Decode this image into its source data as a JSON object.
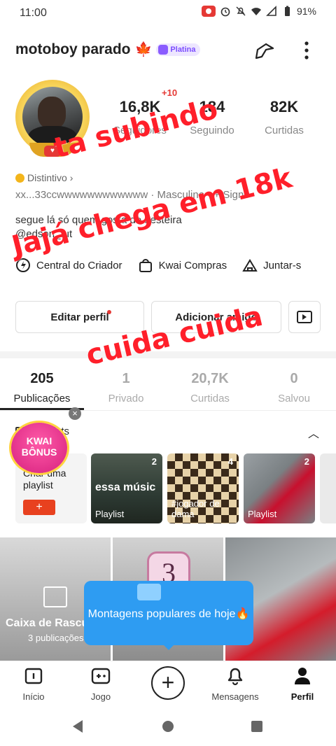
{
  "status_bar": {
    "time": "11:00",
    "battery": "91%"
  },
  "profile": {
    "username": "motoboy parado",
    "flag_emoji": "🍁",
    "tier_badge": "Platina",
    "stats": [
      {
        "value": "16,8K",
        "label": "Seguidores"
      },
      {
        "value": "184",
        "label": "Seguindo"
      },
      {
        "value": "82K",
        "label": "Curtidas"
      }
    ],
    "followers_increase": "+10",
    "distintivo": "Distintivo",
    "id_line": "xx...33ccwwwwwwwwwwww",
    "gender": "Masculino",
    "sign_link": "+ Signo",
    "bio_line1": "segue lá só quem gosta de besteira",
    "bio_line2": "@edson_fut"
  },
  "quick_links": [
    {
      "label": "Central do Criador",
      "icon": "creator-icon"
    },
    {
      "label": "Kwai Compras",
      "icon": "shopping-bag-icon"
    },
    {
      "label": "Juntar-s",
      "icon": "tent-icon"
    }
  ],
  "actions": {
    "edit": "Editar perfil",
    "add_friend": "Adicionar amigo"
  },
  "tabs": [
    {
      "count": "205",
      "label": "Publicações"
    },
    {
      "count": "1",
      "label": "Privado"
    },
    {
      "count": "20,7K",
      "label": "Curtidas"
    },
    {
      "count": "0",
      "label": "Salvou"
    }
  ],
  "playlists": {
    "title": "Playlists",
    "create_label": "Criar uma playlist",
    "kwai_bonus": "KWAI BÔNUS",
    "cards": [
      {
        "count": "2",
        "caption": "Playlist",
        "overlay": "essa músic"
      },
      {
        "count": "4",
        "caption": "#jogador de dama",
        "overlay": ""
      },
      {
        "count": "2",
        "caption": "Playlist",
        "overlay": ""
      }
    ]
  },
  "grid": {
    "draft_title": "Caixa de Rascu",
    "draft_count": "3 publicações",
    "countdown": "3"
  },
  "tooltip": {
    "text": "Montagens populares de hoje🔥"
  },
  "bottom_nav": [
    {
      "label": "Início",
      "icon": "home-icon"
    },
    {
      "label": "Jogo",
      "icon": "gamepad-icon"
    },
    {
      "label": "",
      "icon": "plus-icon"
    },
    {
      "label": "Mensagens",
      "icon": "bell-icon"
    },
    {
      "label": "Perfil",
      "icon": "person-icon"
    }
  ],
  "overlay_texts": {
    "line1": "ta subindo",
    "line2": "Jajá chega em 18k",
    "line3": "cuida cuida"
  },
  "colors": {
    "accent": "#e8411f",
    "overlay": "#ff1f2a",
    "tooltip": "#2e9cf2",
    "tier": "#7b4dff"
  }
}
